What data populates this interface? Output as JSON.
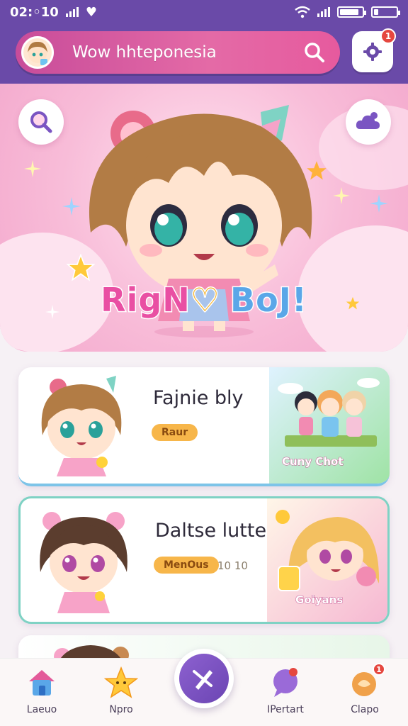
{
  "status_bar": {
    "time": "02:◦10",
    "icons": [
      "signal-icon",
      "heart-icon",
      "wifi-icon",
      "signal-icon",
      "battery-icon",
      "battery-icon"
    ]
  },
  "header": {
    "search_title": "Wow hhteponesia",
    "search_icon": "search-icon",
    "settings_icon": "gear-icon",
    "settings_badge": "1"
  },
  "hero": {
    "left_button_icon": "magnifier-icon",
    "right_button_icon": "cloud-icon",
    "title_parts": [
      "RigN",
      "♡",
      "BoJ!"
    ]
  },
  "cards": [
    {
      "title": "Fajnie bly",
      "badge": "Raur",
      "thumb_label": "Cuny Chot"
    },
    {
      "title": "Daltse lutteh",
      "badge": "MenOus",
      "meta": "10 10",
      "thumb_label": "Goiyans"
    },
    {
      "title": ""
    }
  ],
  "bottom_nav": [
    {
      "label": "Laeuo",
      "icon": "home-icon"
    },
    {
      "label": "Npro",
      "icon": "star-icon"
    },
    {
      "label": "",
      "icon": "pen-icon"
    },
    {
      "label": "IPertart",
      "icon": "chat-bubble-icon",
      "badge": ""
    },
    {
      "label": "Clapo",
      "icon": "bell-icon",
      "badge": "1"
    }
  ],
  "colors": {
    "header": "#6a4aa8",
    "search_bar": "#e46aa6",
    "hero_bg": "#f8bcd8",
    "badge": "#f7b64a",
    "fab": "#7a55c2",
    "notify": "#e5473f"
  }
}
